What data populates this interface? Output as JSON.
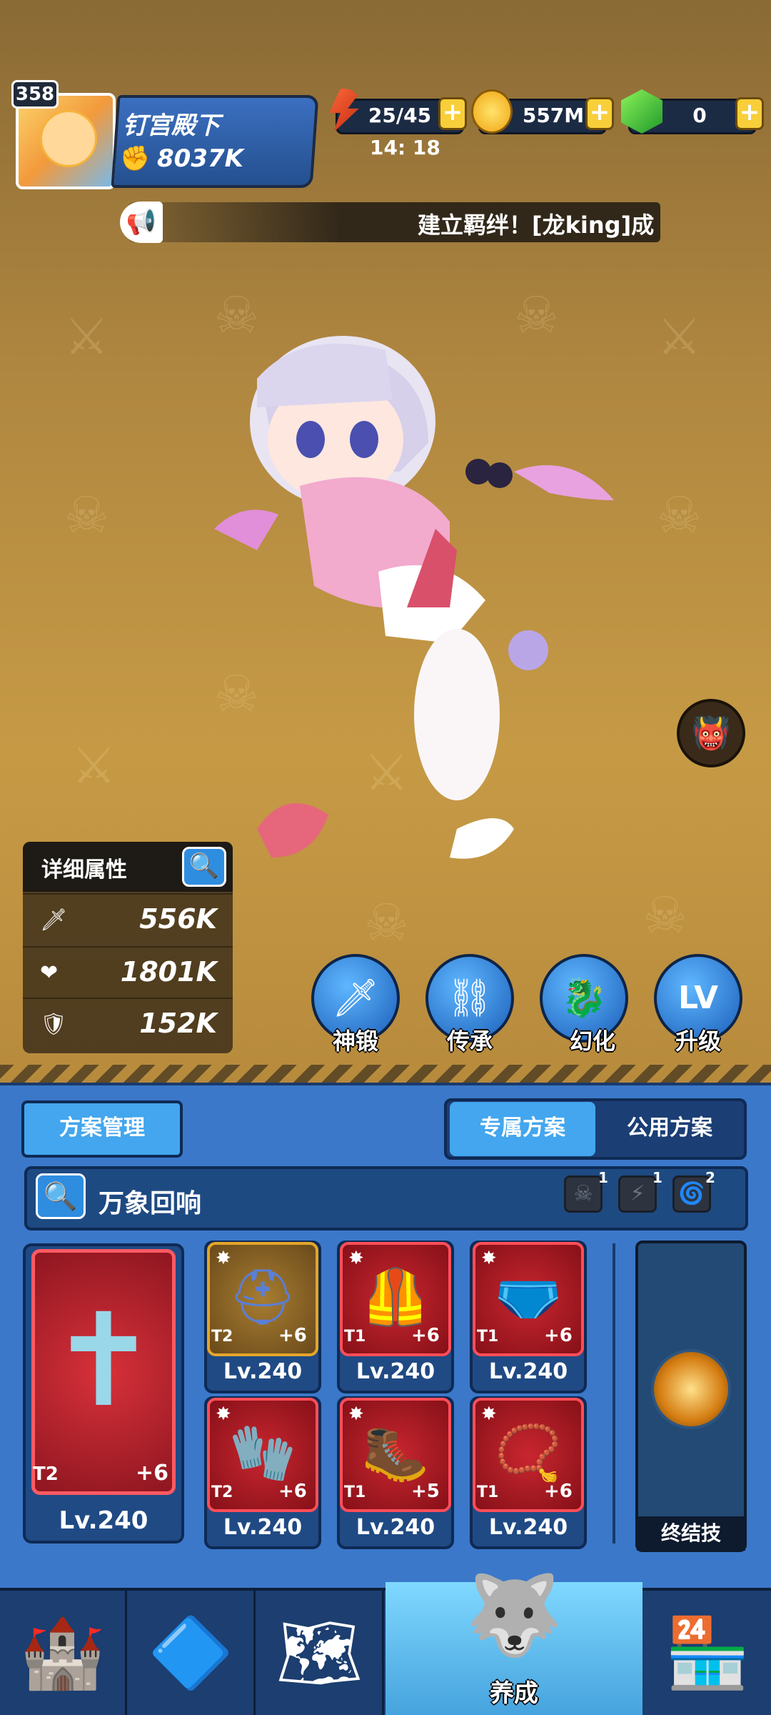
{
  "player": {
    "level": "358",
    "name": "钉宫殿下",
    "power": "8037K"
  },
  "resources": {
    "energy": "25/45",
    "energy_timer": "14: 18",
    "gold": "557M",
    "gems": "0",
    "plus": "+"
  },
  "marquee": {
    "text": "建立羁绊！[龙king]成"
  },
  "stats": {
    "title": "详细属性",
    "attack": "556K",
    "hp": "1801K",
    "defense": "152K"
  },
  "actions": [
    {
      "label": "神锻",
      "icon": "sword-icon"
    },
    {
      "label": "传承",
      "icon": "share-icon"
    },
    {
      "label": "幻化",
      "icon": "dragon-icon"
    },
    {
      "label": "升级",
      "icon": "level-up-icon"
    }
  ],
  "plan": {
    "manage": "方案管理",
    "tab_exclusive": "专属方案",
    "tab_public": "公用方案",
    "search_text": "万象回响",
    "filter_counts": [
      "1",
      "1",
      "2"
    ]
  },
  "weapon": {
    "tier": "T2",
    "plus": "+6",
    "level": "Lv.240"
  },
  "equipment": [
    {
      "tier": "T2",
      "plus": "+6",
      "level": "Lv.240"
    },
    {
      "tier": "T1",
      "plus": "+6",
      "level": "Lv.240"
    },
    {
      "tier": "T1",
      "plus": "+6",
      "level": "Lv.240"
    },
    {
      "tier": "T2",
      "plus": "+6",
      "level": "Lv.240"
    },
    {
      "tier": "T1",
      "plus": "+5",
      "level": "Lv.240"
    },
    {
      "tier": "T1",
      "plus": "+6",
      "level": "Lv.240"
    }
  ],
  "final_skill": {
    "label": "终结技"
  },
  "nav": {
    "active_label": "养成"
  },
  "colors": {
    "panel_blue": "#3b78c9",
    "accent_yellow": "#f8cf3a",
    "equip_red": "#c9262f"
  }
}
